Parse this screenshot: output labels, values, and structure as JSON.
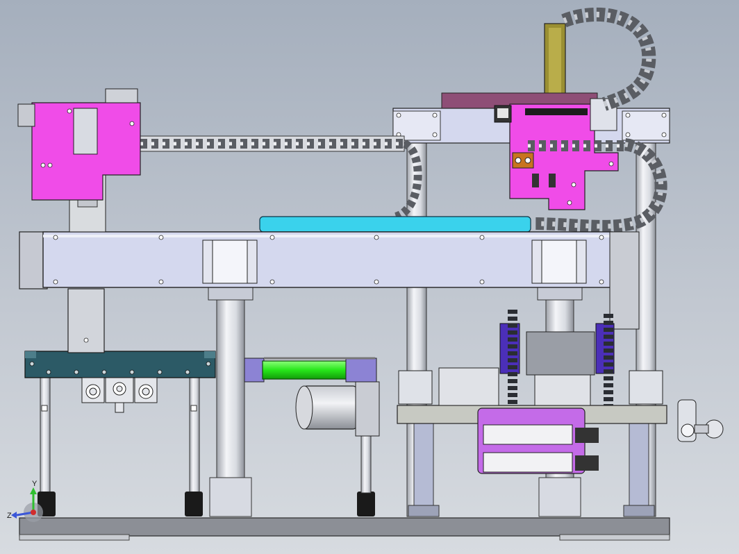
{
  "viewport": {
    "background_top": "#a5afbd",
    "background_bottom": "#d7dbe0"
  },
  "triad": {
    "y_label": "Y",
    "z_label": "Z",
    "y_color": "#2fbf2f",
    "z_color": "#3a56d8"
  },
  "colors": {
    "magenta_plate": "#f04ce8",
    "violet_plate": "#c46be8",
    "cyan_plate": "#3ad2ec",
    "green_cylinder": "#27e61a",
    "olive_rail": "#9a8f32",
    "teal_bracket": "#2c5a66",
    "rail_lavender": "#d4d8ee",
    "column_light": "#e9ebf0",
    "base_plate": "#8c8f96",
    "cable_chain": "#5a5d63",
    "purple_guide": "#4b2fb8",
    "orange_block": "#c8741f"
  },
  "icons": [
    "coordinate-triad-icon",
    "cable-chain-icon",
    "motor-icon",
    "pneumatic-cylinder-icon",
    "valve-icon"
  ]
}
